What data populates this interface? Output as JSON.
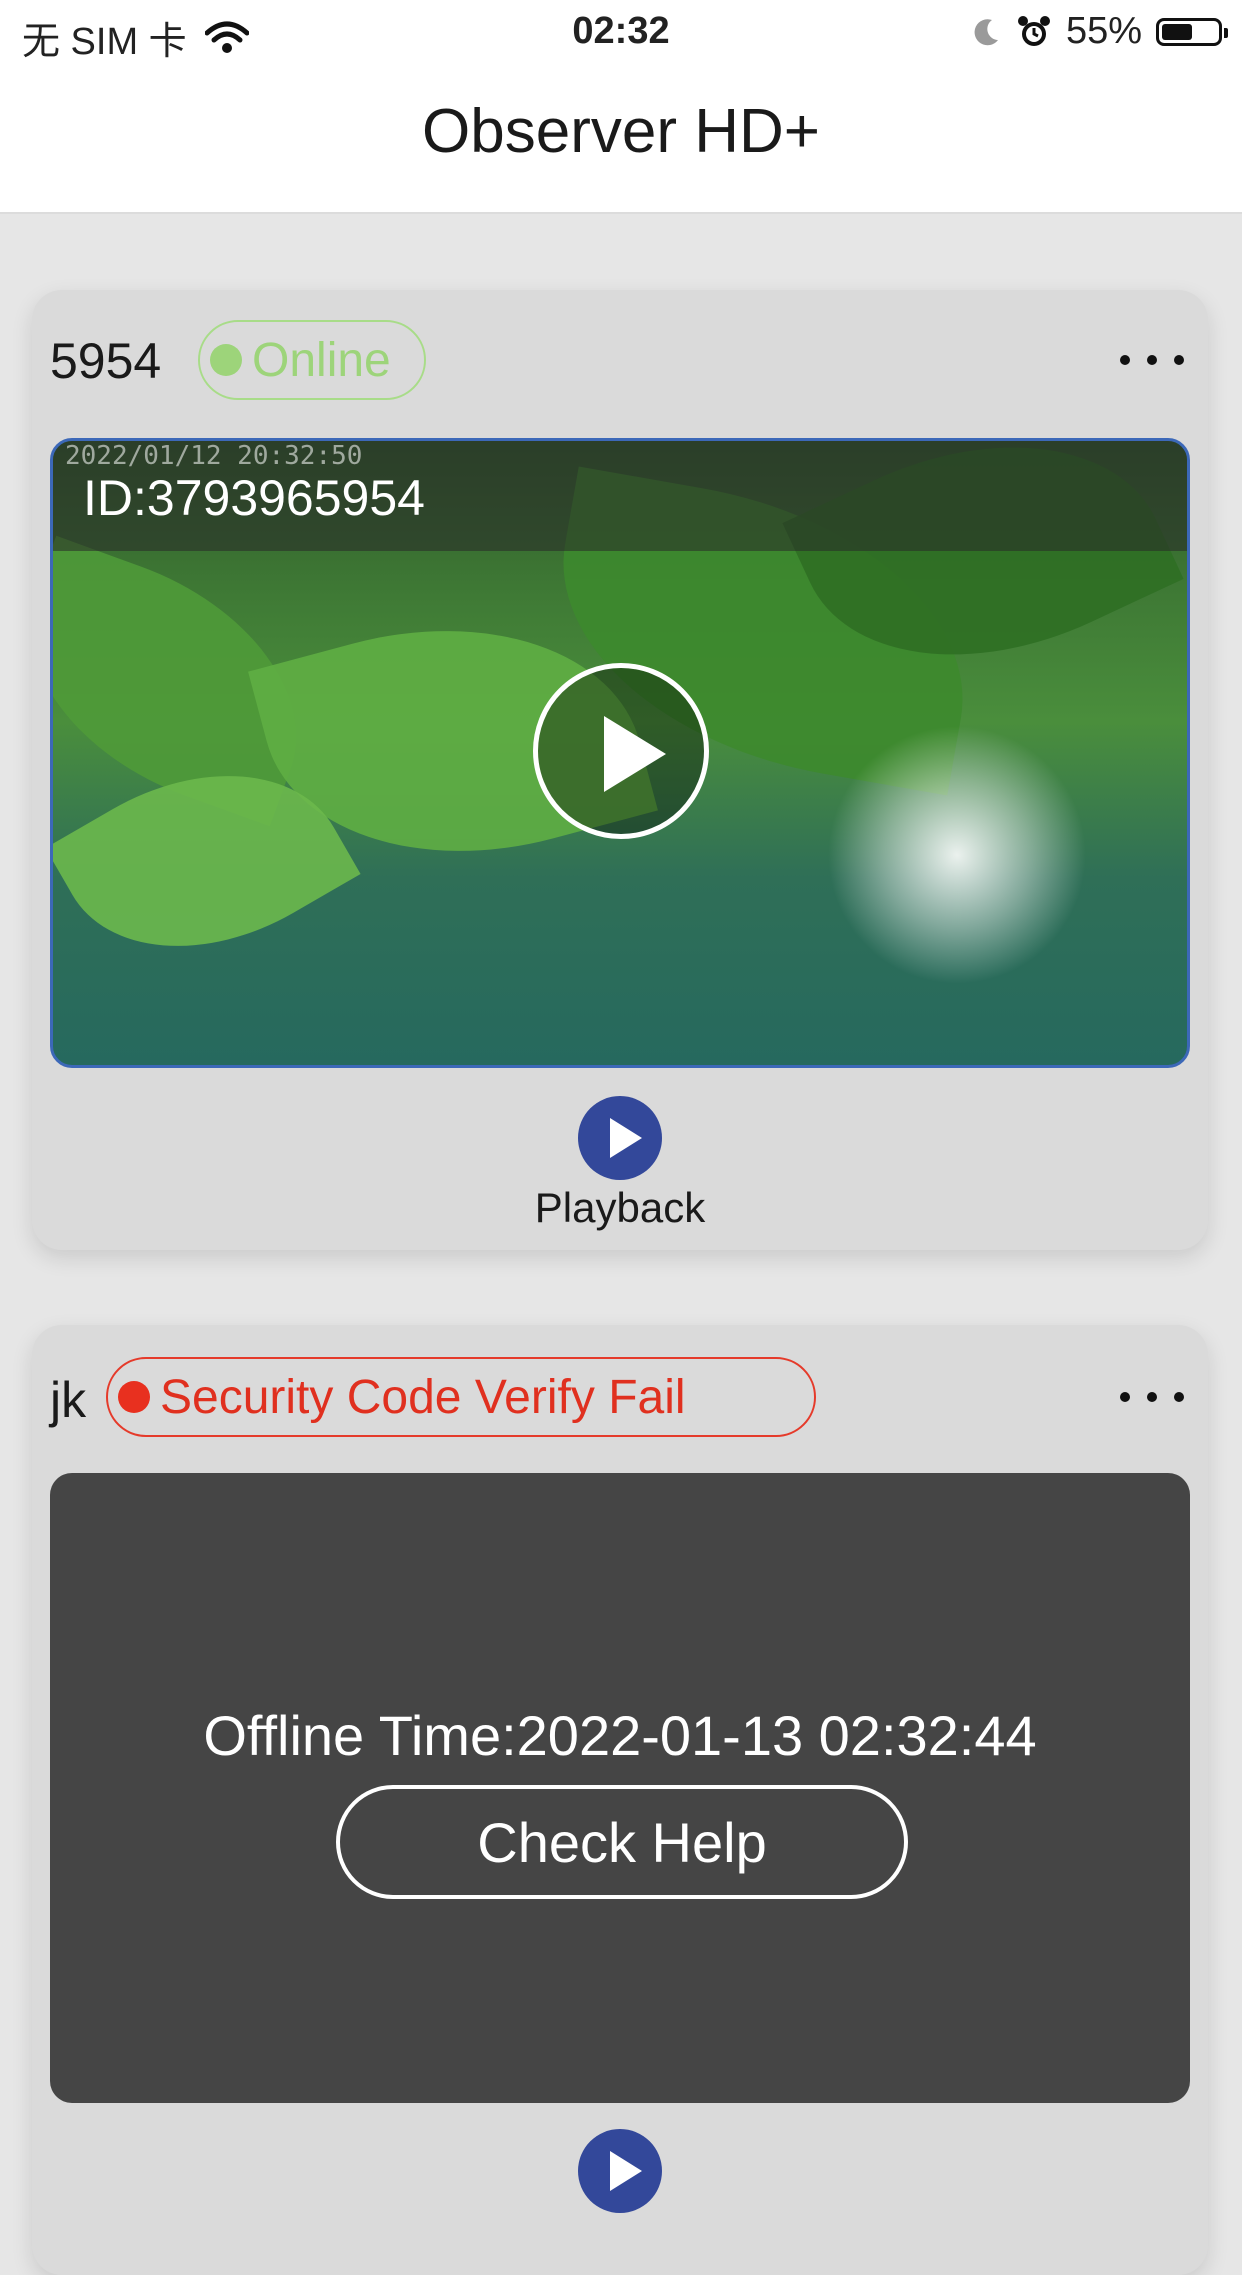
{
  "status_bar": {
    "carrier": "无 SIM 卡",
    "time": "02:32",
    "battery": "55%"
  },
  "nav": {
    "title": "Observer HD+"
  },
  "devices": [
    {
      "name": "5954",
      "status": "Online",
      "camera_id": "ID:3793965954",
      "timestamp_overlay": "2022/01/12 20:32:50",
      "playback_label": "Playback"
    },
    {
      "name": "jk",
      "status": "Security Code Verify Fail",
      "offline_time": "Offline Time:2022-01-13 02:32:44",
      "check_help_label": "Check Help"
    }
  ],
  "colors": {
    "online": "#9dd47a",
    "error": "#e0301f",
    "accent": "#33489a"
  }
}
